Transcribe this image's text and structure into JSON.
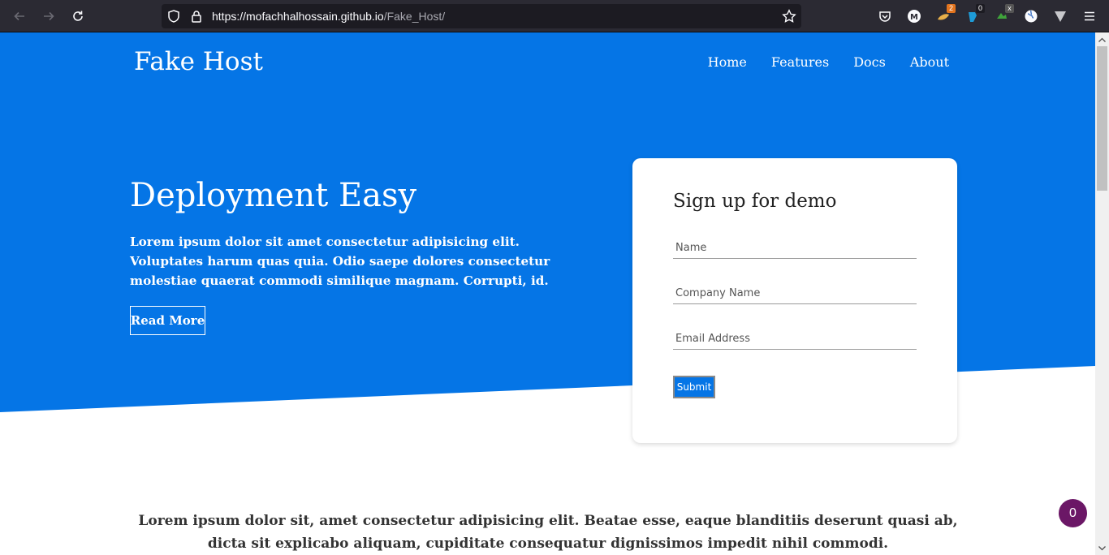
{
  "browser": {
    "url_host": "https://mofachhalhossain.github.io",
    "url_path": "/Fake_Host/",
    "ext_badges": {
      "ext2": "2",
      "ext3": "0",
      "ext4": "x"
    }
  },
  "colors": {
    "hero": "#0575e6",
    "chat": "#6b1766"
  },
  "nav": {
    "brand": "Fake Host",
    "links": [
      "Home",
      "Features",
      "Docs",
      "About"
    ]
  },
  "hero": {
    "title": "Deployment Easy",
    "text": "Lorem ipsum dolor sit amet consectetur adipisicing elit. Voluptates harum quas quia. Odio saepe dolores consectetur molestiae quaerat commodi similique magnam. Corrupti, id.",
    "button": "Read More"
  },
  "signup": {
    "title": "Sign up for demo",
    "name_placeholder": "Name",
    "company_placeholder": "Company Name",
    "email_placeholder": "Email Address",
    "submit": "Submit"
  },
  "section2": {
    "text": "Lorem ipsum dolor sit, amet consectetur adipisicing elit. Beatae esse, eaque blanditiis deserunt quasi ab, dicta sit explicabo aliquam, cupiditate consequatur dignissimos impedit nihil commodi."
  },
  "chat": {
    "count": "0"
  }
}
